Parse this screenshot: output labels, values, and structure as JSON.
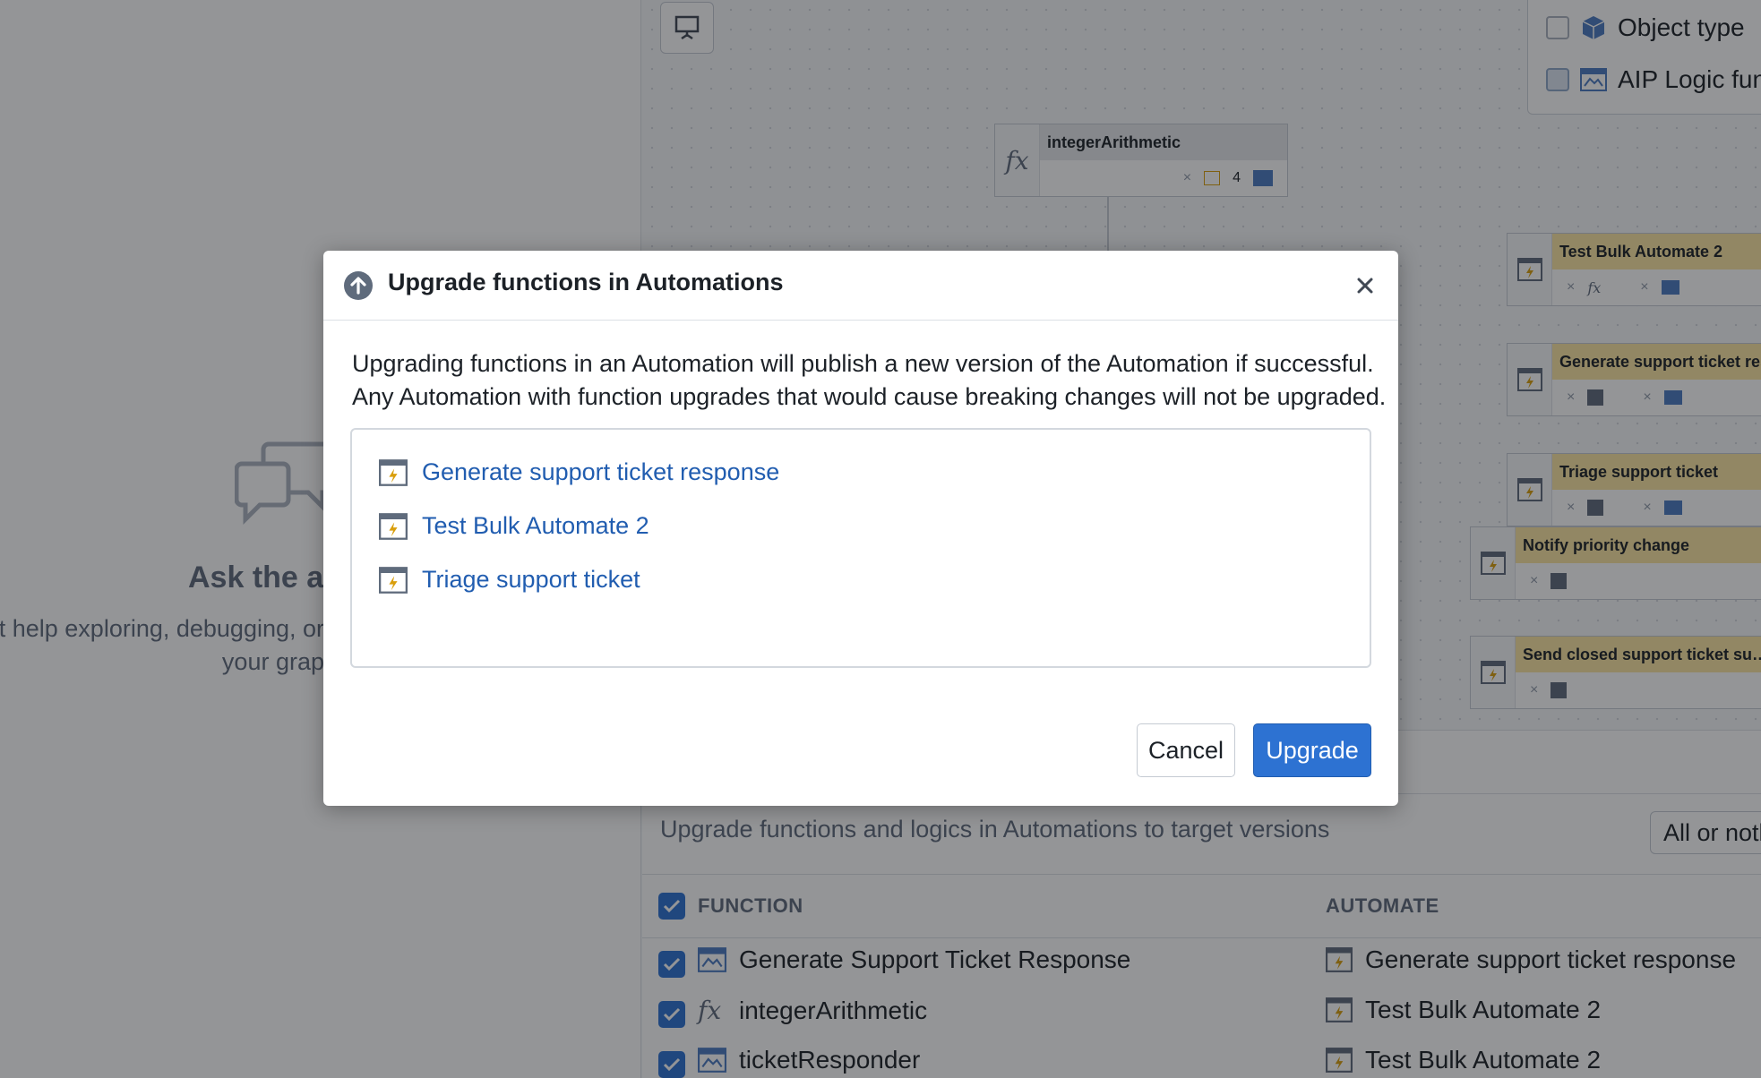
{
  "left_panel": {
    "title": "Ask the ag",
    "description_lines": [
      "t help exploring, debugging, or",
      "your grap"
    ]
  },
  "legend": {
    "items": [
      {
        "label": "Object type",
        "icon": "cube-icon"
      },
      {
        "label": "AIP Logic func",
        "icon": "aip-logic-icon"
      }
    ]
  },
  "graph": {
    "nodes": [
      {
        "title": "integerArithmetic",
        "kind": "function",
        "badge": "4"
      },
      {
        "title": "Test Bulk Automate 2",
        "kind": "automate"
      },
      {
        "title": "Generate support ticket res",
        "kind": "automate"
      },
      {
        "title": "Triage support ticket",
        "kind": "automate"
      },
      {
        "title": "Notify priority change",
        "kind": "automate"
      },
      {
        "title": "Send closed support ticket su…",
        "kind": "automate"
      }
    ]
  },
  "bottom": {
    "title": "Upgrade functions and logics in Automations to target versions",
    "select_value": "All or noth",
    "columns": {
      "function": "FUNCTION",
      "automate": "AUTOMATE"
    },
    "rows": [
      {
        "function": "Generate Support Ticket Response",
        "function_icon": "aip-logic-icon",
        "automate": "Generate support ticket response"
      },
      {
        "function": "integerArithmetic",
        "function_icon": "fx-icon",
        "automate": "Test Bulk Automate 2"
      },
      {
        "function": "ticketResponder",
        "function_icon": "aip-logic-icon",
        "automate": "Test Bulk Automate 2"
      }
    ]
  },
  "dialog": {
    "title": "Upgrade functions in Automations",
    "description_lines": [
      "Upgrading functions in an Automation will publish a new version of the Automation if successful.",
      "Any Automation with function upgrades that would cause breaking changes will not be upgraded."
    ],
    "items": [
      "Generate support ticket response",
      "Test Bulk Automate 2",
      "Triage support ticket"
    ],
    "cancel_label": "Cancel",
    "confirm_label": "Upgrade"
  },
  "colors": {
    "primary": "#2d72d2",
    "link": "#215db0",
    "automate_header": "#fbe6a2",
    "automate_icon": "#d99e0b"
  }
}
